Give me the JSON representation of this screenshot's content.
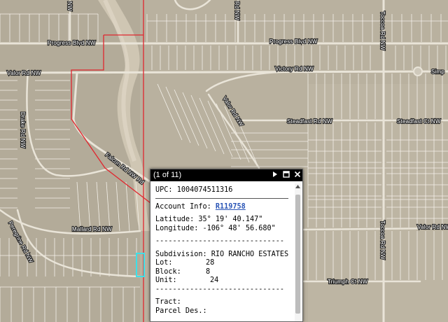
{
  "map": {
    "roads": [
      {
        "id": "progress",
        "label": "Progress Blvd NW"
      },
      {
        "id": "progress2",
        "label": "Progress Blvd NW"
      },
      {
        "id": "valor",
        "label": "Valor Rd NW"
      },
      {
        "id": "victory",
        "label": "Victory Rd NW"
      },
      {
        "id": "simp",
        "label": "Simp"
      },
      {
        "id": "valor-diag",
        "label": "Valor Rd NW"
      },
      {
        "id": "steadfast",
        "label": "Steadfast Rd NW"
      },
      {
        "id": "steadfast-ct",
        "label": "Steadfast Ct NW"
      },
      {
        "id": "drake",
        "label": "Drake Rd NW"
      },
      {
        "id": "falcon",
        "label": "Falcon Rd NW Rd"
      },
      {
        "id": "mallard",
        "label": "Mallard Rd NW"
      },
      {
        "id": "peregrine",
        "label": "Peregrine Rd NW"
      },
      {
        "id": "toccoa-top",
        "label": "Toccoa Rd NW"
      },
      {
        "id": "toccoa-bottom",
        "label": "Toccoa Rd NW"
      },
      {
        "id": "valor-right",
        "label": "Valor Rd NW"
      },
      {
        "id": "triumph",
        "label": "Triumph Ct NW"
      },
      {
        "id": "top-left",
        "label": "NW"
      },
      {
        "id": "top-mid",
        "label": "Rd NW"
      }
    ],
    "colors": {
      "terrain": "#b9b19f",
      "parcel_line": "#ffffff",
      "boundary": "#e0272f",
      "selection": "#3de0e8"
    }
  },
  "popup": {
    "count": "(1 of 11)",
    "icons": {
      "next": "next-arrow-icon",
      "maximize": "maximize-icon",
      "close": "close-icon"
    },
    "upc_label": "UPC:",
    "upc_value": "1004074511316",
    "account_label": "Account Info:",
    "account_value": "R119758",
    "latitude_label": "Latitude:",
    "latitude_value": "35° 19' 40.147\"",
    "longitude_label": "Longitude:",
    "longitude_value": "-106° 48' 56.680\"",
    "divider": "------------------------------",
    "subdivision_label": "Subdivision:",
    "subdivision_value": "RIO RANCHO ESTATES",
    "lot_label": "Lot:",
    "lot_value": "28",
    "block_label": "Block:",
    "block_value": "8",
    "unit_label": "Unit:",
    "unit_value": "24",
    "tract_label": "Tract:",
    "parcel_label": "Parcel Des.:"
  }
}
